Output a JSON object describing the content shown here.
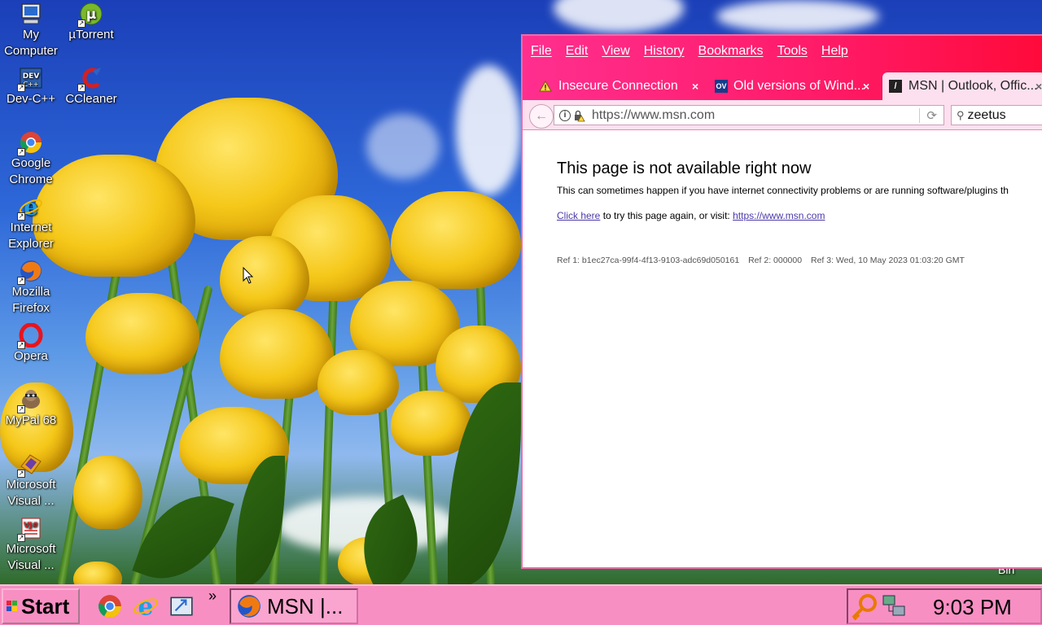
{
  "desktop": {
    "icons": [
      {
        "label": "My Computer",
        "icon": "computer-icon"
      },
      {
        "label": "µTorrent",
        "icon": "utorrent-icon"
      },
      {
        "label": "Dev-C++",
        "icon": "devcpp-icon"
      },
      {
        "label": "CCleaner",
        "icon": "ccleaner-icon"
      },
      {
        "label": "Google Chrome",
        "icon": "chrome-icon"
      },
      {
        "label": "Internet Explorer",
        "icon": "ie-icon"
      },
      {
        "label": "Mozilla Firefox",
        "icon": "firefox-icon"
      },
      {
        "label": "Opera",
        "icon": "opera-icon"
      },
      {
        "label": "MyPal 68",
        "icon": "mypal-icon"
      },
      {
        "label": "Microsoft Visual ...",
        "icon": "visual-studio-icon"
      },
      {
        "label": "Microsoft Visual ...",
        "icon": "visual-jsharp-icon"
      }
    ],
    "corner_text": "Bin"
  },
  "browser": {
    "menu": [
      "File",
      "Edit",
      "View",
      "History",
      "Bookmarks",
      "Tools",
      "Help"
    ],
    "tabs": [
      {
        "label": "Insecure Connection",
        "icon": "warning-icon",
        "active": false
      },
      {
        "label": "Old versions of Wind...",
        "icon": "oldversion-icon",
        "active": false
      },
      {
        "label": "MSN | Outlook, Offic...",
        "icon": "msn-icon",
        "active": true
      }
    ],
    "url": "https://www.msn.com",
    "search_value": "zeetus",
    "page": {
      "heading": "This page is not available right now",
      "description": "This can sometimes happen if you have internet connectivity problems or are running software/plugins th",
      "click_here": "Click here",
      "retry_text": " to try this page again, or visit: ",
      "retry_link": "https://www.msn.com",
      "ref1": "Ref 1: b1ec27ca-99f4-4f13-9103-adc69d050161",
      "ref2": "Ref 2: 000000",
      "ref3": "Ref 3: Wed, 10 May 2023 01:03:20 GMT"
    }
  },
  "taskbar": {
    "start_label": "Start",
    "task_label": "MSN |...",
    "overflow": "»",
    "clock": "9:03 PM"
  },
  "colors": {
    "browser_accent": "#ff1a66",
    "taskbar": "#f78fc3",
    "link": "#4b3aa8"
  }
}
